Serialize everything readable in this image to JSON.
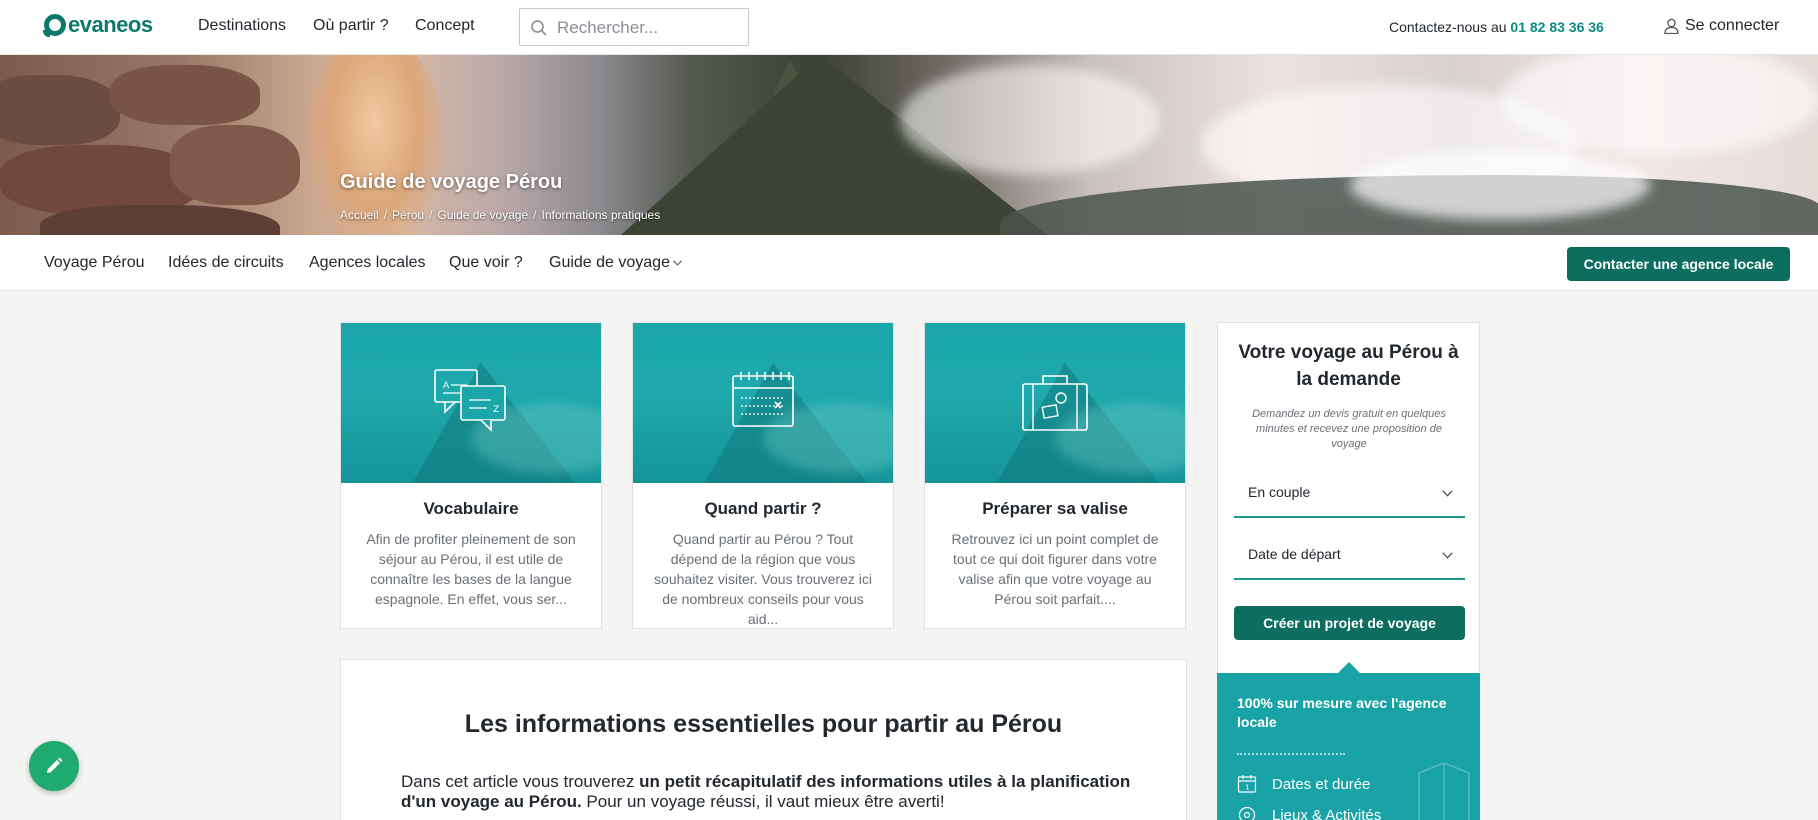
{
  "brand": {
    "name": "evaneos",
    "accent": "#0b7a6b",
    "button": "#0d6e60",
    "teal": "#1aa3a7"
  },
  "topnav": {
    "links": [
      "Destinations",
      "Où partir ?",
      "Concept"
    ],
    "search_placeholder": "Rechercher...",
    "contact_label": "Contactez-nous au",
    "phone": "01 82 83 36 36",
    "login_label": "Se connecter"
  },
  "hero": {
    "title": "Guide de voyage Pérou",
    "breadcrumb": [
      "Accueil",
      "Pérou",
      "Guide de voyage",
      "Informations pratiques"
    ]
  },
  "subnav": {
    "items": [
      "Voyage Pérou",
      "Idées de circuits",
      "Agences locales",
      "Que voir ?",
      "Guide de voyage"
    ],
    "cta": "Contacter une agence locale"
  },
  "cards": [
    {
      "icon": "speech-bubbles-icon",
      "title": "Vocabulaire",
      "desc": "Afin de profiter pleinement de son séjour au Pérou, il est utile de connaître les bases de la langue espagnole. En effet, vous ser..."
    },
    {
      "icon": "calendar-icon",
      "title": "Quand partir ?",
      "desc": "Quand partir au Pérou ? Tout dépend de la région que vous souhaitez visiter. Vous trouverez ici de nombreux conseils pour vous aid..."
    },
    {
      "icon": "suitcase-icon",
      "title": "Préparer sa valise",
      "desc": "Retrouvez ici un point complet de tout ce qui doit figurer dans votre valise afin que votre voyage au Pérou soit parfait...."
    }
  ],
  "article": {
    "title": "Les informations essentielles pour partir au Pérou",
    "intro_plain": "Dans cet article vous trouverez ",
    "intro_bold": "un petit récapitulatif des informations utiles à la planification d'un voyage au Pérou.",
    "intro_end": " Pour un voyage réussi, il vaut mieux être averti!"
  },
  "sidebar": {
    "title": "Votre voyage au Pérou à la demande",
    "subtitle": "Demandez un devis gratuit en quelques minutes et recevez une proposition de voyage",
    "select_travelers": "En couple",
    "select_date": "Date de départ",
    "cta": "Créer un projet de voyage",
    "teal_title": "100% sur mesure avec l'agence locale",
    "features": [
      "Dates et durée",
      "Lieux & Activités"
    ]
  }
}
